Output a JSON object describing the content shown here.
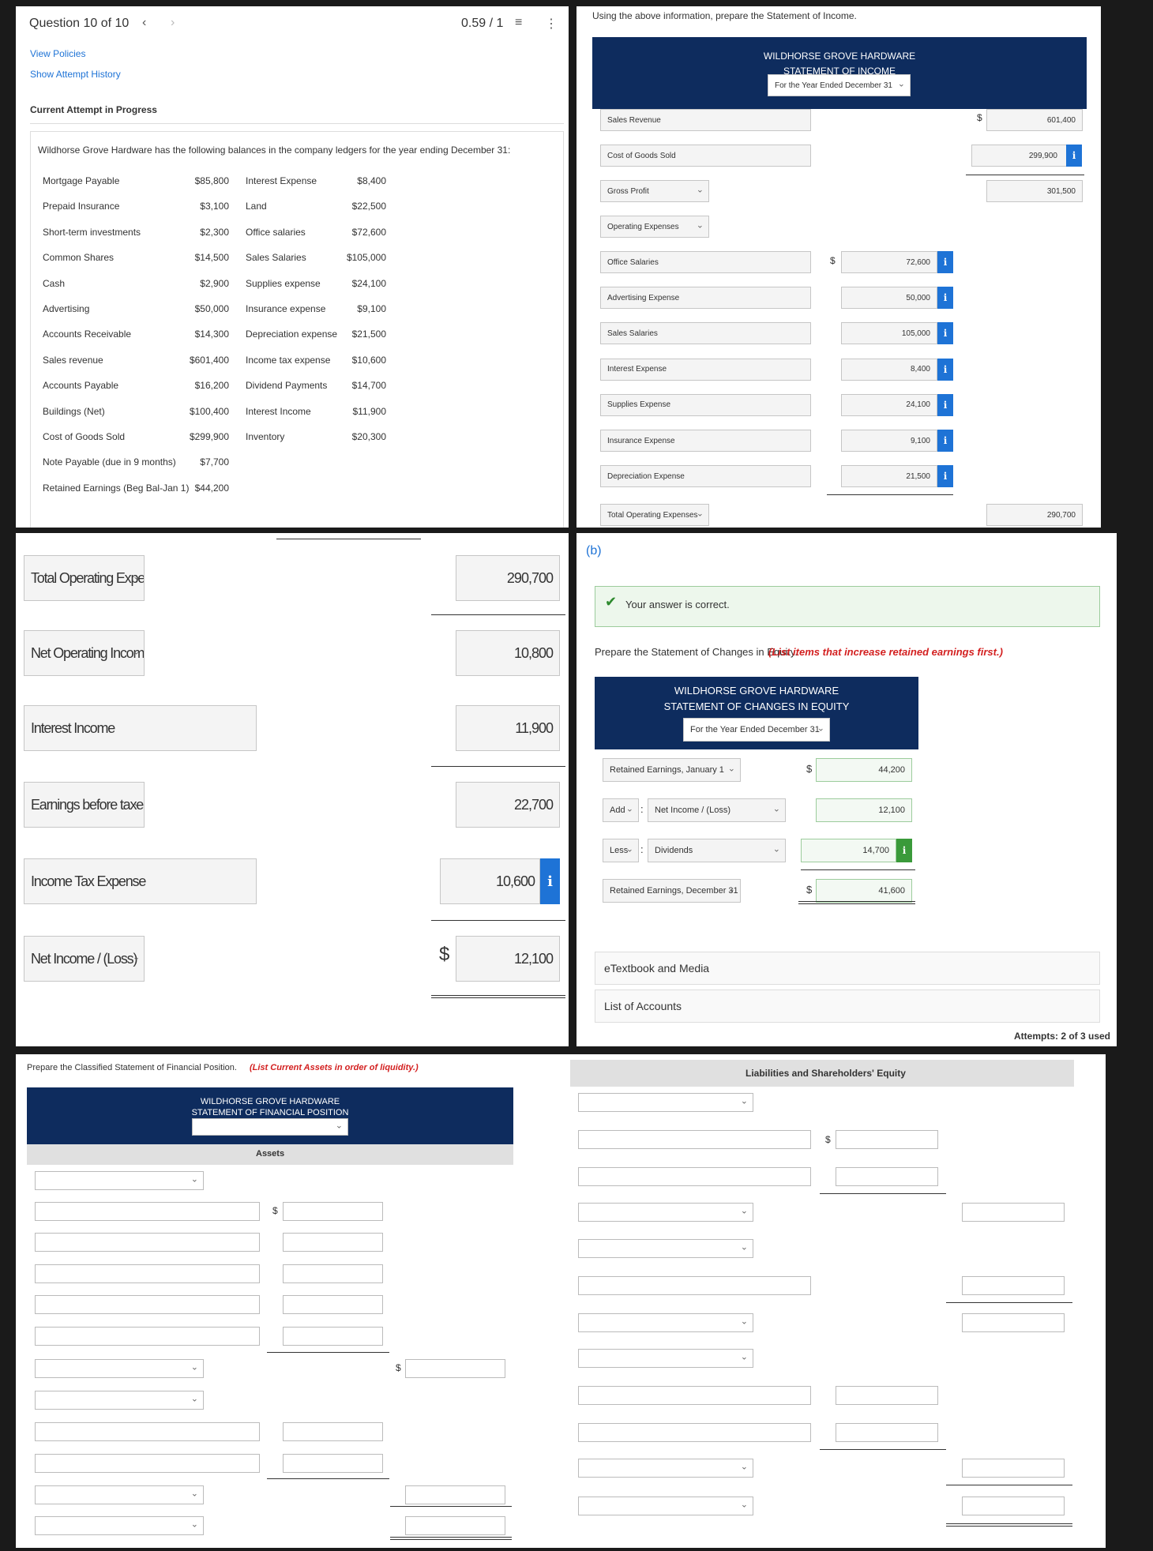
{
  "header": {
    "question": "Question 10 of 10",
    "score": "0.59 / 1",
    "view_policies": "View Policies",
    "show_attempt_history": "Show Attempt History",
    "current_attempt": "Current Attempt in Progress"
  },
  "problem": {
    "intro": "Wildhorse Grove Hardware has the following balances in the company ledgers for the year ending December 31:",
    "ledger_left": [
      {
        "name": "Mortgage Payable",
        "amount": "$85,800"
      },
      {
        "name": "Prepaid Insurance",
        "amount": "$3,100"
      },
      {
        "name": "Short-term investments",
        "amount": "$2,300"
      },
      {
        "name": "Common Shares",
        "amount": "$14,500"
      },
      {
        "name": "Cash",
        "amount": "$2,900"
      },
      {
        "name": "Advertising",
        "amount": "$50,000"
      },
      {
        "name": "Accounts Receivable",
        "amount": "$14,300"
      },
      {
        "name": "Sales revenue",
        "amount": "$601,400"
      },
      {
        "name": "Accounts Payable",
        "amount": "$16,200"
      },
      {
        "name": "Buildings (Net)",
        "amount": "$100,400"
      },
      {
        "name": "Cost of Goods Sold",
        "amount": "$299,900"
      },
      {
        "name": "Note Payable (due in 9 months)",
        "amount": "$7,700"
      },
      {
        "name": "Retained Earnings (Beg Bal-Jan 1)",
        "amount": "$44,200"
      }
    ],
    "ledger_right": [
      {
        "name": "Interest Expense",
        "amount": "$8,400"
      },
      {
        "name": "Land",
        "amount": "$22,500"
      },
      {
        "name": "Office salaries",
        "amount": "$72,600"
      },
      {
        "name": "Sales Salaries",
        "amount": "$105,000"
      },
      {
        "name": "Supplies expense",
        "amount": "$24,100"
      },
      {
        "name": "Insurance expense",
        "amount": "$9,100"
      },
      {
        "name": "Depreciation expense",
        "amount": "$21,500"
      },
      {
        "name": "Income tax expense",
        "amount": "$10,600"
      },
      {
        "name": "Dividend Payments",
        "amount": "$14,700"
      },
      {
        "name": "Interest Income",
        "amount": "$11,900"
      },
      {
        "name": "Inventory",
        "amount": "$20,300"
      }
    ]
  },
  "income": {
    "instruction": "Using the above information, prepare the Statement of Income.",
    "company": "WILDHORSE GROVE HARDWARE",
    "title": "STATEMENT OF INCOME",
    "period": "For the Year Ended December 31",
    "currency": "$",
    "sales_revenue": "Sales Revenue",
    "sales_revenue_val": "601,400",
    "cogs": "Cost of Goods Sold",
    "cogs_val": "299,900",
    "gross_profit": "Gross Profit",
    "gross_profit_val": "301,500",
    "opex": "Operating Expenses",
    "expenses": [
      {
        "label": "Office Salaries",
        "value": "72,600"
      },
      {
        "label": "Advertising Expense",
        "value": "50,000"
      },
      {
        "label": "Sales Salaries",
        "value": "105,000"
      },
      {
        "label": "Interest Expense",
        "value": "8,400"
      },
      {
        "label": "Supplies Expense",
        "value": "24,100"
      },
      {
        "label": "Insurance Expense",
        "value": "9,100"
      },
      {
        "label": "Depreciation Expense",
        "value": "21,500"
      }
    ],
    "total_opex": "Total Operating Expenses",
    "total_opex_val": "290,700"
  },
  "income_zoom": {
    "total_opex": "Total Operating Expenses",
    "total_opex_val": "290,700",
    "net_operating": "Net Operating Income",
    "net_operating_val": "10,800",
    "interest_income": "Interest Income",
    "interest_income_val": "11,900",
    "ebt": "Earnings before taxes",
    "ebt_val": "22,700",
    "tax": "Income Tax Expense",
    "tax_val": "10,600",
    "net_income": "Net Income / (Loss)",
    "net_income_val": "12,100",
    "currency": "$"
  },
  "equity": {
    "part": "(b)",
    "correct": "Your answer is correct.",
    "instruction": "Prepare the Statement of Changes in Equity.",
    "instruction_note": "(List items that increase retained earnings first.)",
    "company": "WILDHORSE GROVE HARDWARE",
    "title": "STATEMENT OF CHANGES IN EQUITY",
    "period": "For the Year Ended December 31",
    "currency": "$",
    "re_jan": "Retained Earnings, January 1",
    "re_jan_val": "44,200",
    "add": "Add",
    "net_income": "Net Income / (Loss)",
    "net_income_val": "12,100",
    "less": "Less",
    "dividends": "Dividends",
    "dividends_val": "14,700",
    "re_dec": "Retained Earnings, December 31",
    "re_dec_val": "41,600",
    "etextbook": "eTextbook and Media",
    "list_accounts": "List of Accounts",
    "attempts": "Attempts: 2 of 3 used"
  },
  "position": {
    "instruction": "Prepare the Classified Statement of Financial Position.",
    "instruction_note": "(List Current Assets in order of liquidity.)",
    "company": "WILDHORSE GROVE HARDWARE",
    "title": "STATEMENT OF FINANCIAL POSITION",
    "assets": "Assets",
    "liabilities": "Liabilities and Shareholders' Equity",
    "currency": "$"
  }
}
